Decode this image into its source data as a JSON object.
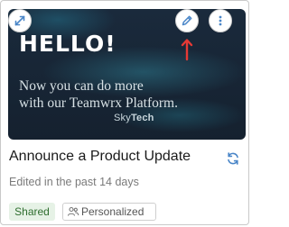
{
  "thumbnail": {
    "headline": "HELLO!",
    "line1": "Now you can do more",
    "line2": "with our Teamwrx Platform.",
    "logo_sky": "Sky",
    "logo_tech": "Tech"
  },
  "actions": {
    "expand_icon": "expand-icon",
    "edit_icon": "pencil-icon",
    "more_icon": "more-vertical-icon"
  },
  "card": {
    "title": "Announce a Product Update",
    "subtitle": "Edited in the past 14 days",
    "status_badge": "Shared",
    "personalized_badge": "Personalized"
  },
  "colors": {
    "accent": "#4a86c8",
    "pointer_arrow": "#e53935",
    "shared_bg": "#e6f2e6",
    "shared_text": "#2f6e2f"
  }
}
